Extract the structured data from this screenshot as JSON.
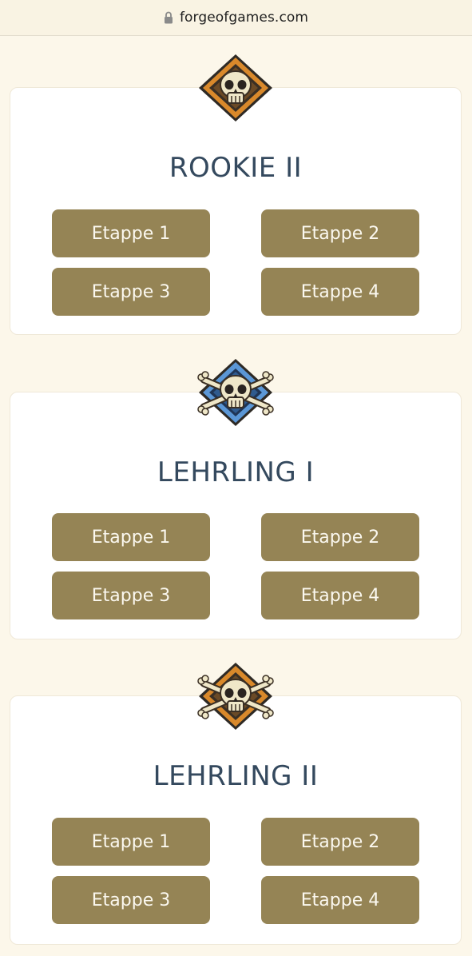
{
  "browser": {
    "url": "forgeofgames.com"
  },
  "leagues": [
    {
      "title": "ROOKIE II",
      "badge": "skull-diamond-orange-icon",
      "stages": [
        "Etappe 1",
        "Etappe 2",
        "Etappe 3",
        "Etappe 4"
      ]
    },
    {
      "title": "LEHRLING I",
      "badge": "skull-crossbones-blue-icon",
      "stages": [
        "Etappe 1",
        "Etappe 2",
        "Etappe 3",
        "Etappe 4"
      ]
    },
    {
      "title": "LEHRLING II",
      "badge": "skull-crossbones-orange-icon",
      "stages": [
        "Etappe 1",
        "Etappe 2",
        "Etappe 3",
        "Etappe 4"
      ]
    }
  ],
  "colors": {
    "page_background": "#fcf7ea",
    "button": "#958455",
    "button_text": "#fbf8ef",
    "title": "#34495e",
    "badge_orange": "#d9892b",
    "badge_blue": "#5b97d6"
  }
}
